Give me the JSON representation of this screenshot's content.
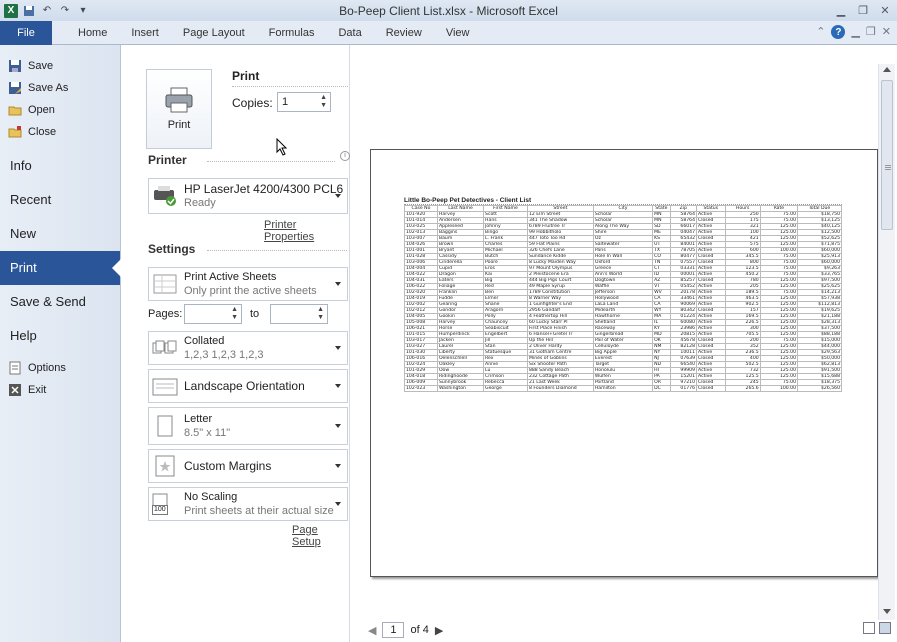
{
  "window": {
    "title": "Bo-Peep Client List.xlsx - Microsoft Excel",
    "app_icon": "X"
  },
  "ribbon": {
    "tabs": [
      "File",
      "Home",
      "Insert",
      "Page Layout",
      "Formulas",
      "Data",
      "Review",
      "View"
    ]
  },
  "nav": {
    "small_top": [
      {
        "label": "Save",
        "icon": "save-icon"
      },
      {
        "label": "Save As",
        "icon": "save-as-icon"
      },
      {
        "label": "Open",
        "icon": "open-folder-icon"
      },
      {
        "label": "Close",
        "icon": "close-file-icon"
      }
    ],
    "large": [
      "Info",
      "Recent",
      "New",
      "Print",
      "Save & Send",
      "Help"
    ],
    "active": "Print",
    "small_bottom": [
      {
        "label": "Options",
        "icon": "options-icon"
      },
      {
        "label": "Exit",
        "icon": "exit-icon"
      }
    ]
  },
  "print_panel": {
    "heading": "Print",
    "button_label": "Print",
    "copies_label": "Copies:",
    "copies_value": "1",
    "printer_heading": "Printer",
    "printer_name": "HP LaserJet 4200/4300 PCL6",
    "printer_status": "Ready",
    "printer_properties": "Printer Properties",
    "settings_heading": "Settings",
    "what_main": "Print Active Sheets",
    "what_sub": "Only print the active sheets",
    "pages_label": "Pages:",
    "pages_from": "",
    "pages_to_label": "to",
    "pages_to": "",
    "collate_main": "Collated",
    "collate_sub": "1,2,3   1,2,3   1,2,3",
    "orientation": "Landscape Orientation",
    "paper_main": "Letter",
    "paper_sub": "8.5\" x 11\"",
    "margins": "Custom Margins",
    "scaling_main": "No Scaling",
    "scaling_sub": "Print sheets at their actual size",
    "scaling_badge": "100",
    "page_setup": "Page Setup"
  },
  "preview": {
    "sheet_title": "Little Bo-Peep Pet Detectives - Client List",
    "headers": [
      "Case No",
      "Last Name",
      "First Name",
      "Street",
      "City",
      "State",
      "Zip",
      "Status",
      "Hours",
      "Rate",
      "Total Due"
    ],
    "rows": [
      [
        "101-920",
        "Harvey",
        "Scott",
        "12 Elm Street",
        "Scholar",
        "MN",
        "58764",
        "Active",
        "250",
        "75.00",
        "$18,750"
      ],
      [
        "101-014",
        "Andersen",
        "Hans",
        "341 The Shadow",
        "Scholar",
        "MN",
        "58764",
        "Closed",
        "175",
        "75.00",
        "$13,125"
      ],
      [
        "103-025",
        "Appleseed",
        "Johnny",
        "6789 Fruitree Tr",
        "Along The Way",
        "SD",
        "66017",
        "Active",
        "321",
        "125.00",
        "$40,125"
      ],
      [
        "102-013",
        "Baggins",
        "Bingo",
        "99 Hobbitholo",
        "Shire",
        "ME",
        "04047",
        "Active",
        "100",
        "125.00",
        "$12,500"
      ],
      [
        "103-007",
        "Baum",
        "L. Frank",
        "447 Toto Too Rd",
        "Oz",
        "KS",
        "65432",
        "Closed",
        "421",
        "125.00",
        "$52,625"
      ],
      [
        "104-026",
        "Brown",
        "Charles",
        "59 Flat Plains",
        "Saltewater",
        "UT",
        "84001",
        "Active",
        "575",
        "125.00",
        "$71,875"
      ],
      [
        "101-001",
        "Bryant",
        "Michael",
        "326 Chefs Lane",
        "Paris",
        "TX",
        "78705",
        "Active",
        "600",
        "100.00",
        "$60,000"
      ],
      [
        "101-028",
        "Cassidy",
        "Butch",
        "Sundance Kidde",
        "Hole In Wall",
        "CO",
        "80477",
        "Closed",
        "345.5",
        "75.00",
        "$25,913"
      ],
      [
        "103-006",
        "Cinderella",
        "Poore",
        "8 Lucky Maiden Way",
        "Oxford",
        "TN",
        "07557",
        "Closed",
        "800",
        "75.00",
        "$60,000"
      ],
      [
        "104-004",
        "Cupid",
        "Eros",
        "97 Mount Olympus",
        "Greece",
        "CT",
        "03331",
        "Active",
        "123.5",
        "75.00",
        "$9,263"
      ],
      [
        "104-022",
        "Dragon",
        "Kai",
        "2 Pleistocene Era",
        "Ann's World",
        "ID",
        "00001",
        "Active",
        "450.2",
        "75.00",
        "$33,765"
      ],
      [
        "104-031",
        "Eaters",
        "Big",
        "444 Big Pigs Court",
        "Dogtown",
        "AZ",
        "85257",
        "Closed",
        "780",
        "125.00",
        "$97,500"
      ],
      [
        "106-022",
        "Foliage",
        "Red",
        "49 Maple Syrup",
        "Waffle",
        "VT",
        "05452",
        "Active",
        "205",
        "125.00",
        "$25,625"
      ],
      [
        "102-020",
        "Franklin",
        "Ben",
        "1789 Constitution",
        "Jefferson",
        "WV",
        "20178",
        "Active",
        "189.5",
        "75.00",
        "$14,213"
      ],
      [
        "104-019",
        "Fudde",
        "Elmer",
        "8 Warner Way",
        "Hollywood",
        "CA",
        "33461",
        "Active",
        "463.5",
        "125.00",
        "$57,938"
      ],
      [
        "102-002",
        "Gearing",
        "Shane",
        "1 Gunfighter's End",
        "LaLa Land",
        "CA",
        "90069",
        "Active",
        "902.5",
        "125.00",
        "$112,813"
      ],
      [
        "102-012",
        "Gondor",
        "Aragorn",
        "2956 Gandalf",
        "Midearth",
        "WY",
        "80342",
        "Closed",
        "157",
        "125.00",
        "$19,625"
      ],
      [
        "104-005",
        "Gookin",
        "Polly",
        "4 Feathertop Hill",
        "Hawthorne",
        "MA",
        "01224",
        "Active",
        "169.5",
        "125.00",
        "$21,188"
      ],
      [
        "105-008",
        "Harvey",
        "Chauncey",
        "60 Lucky Starr Pl",
        "Shetland",
        "IL",
        "60080",
        "Active",
        "226.5",
        "125.00",
        "$28,313"
      ],
      [
        "106-021",
        "Horse",
        "Seabiscuit",
        "First Place Finish",
        "Raceway",
        "KY",
        "23986",
        "Active",
        "300",
        "125.00",
        "$37,500"
      ],
      [
        "101-015",
        "Humperdinck",
        "Engelbert",
        "6 Hansel+Gretel Tr",
        "Gingerbread",
        "MD",
        "20815",
        "Active",
        "705.5",
        "125.00",
        "$88,188"
      ],
      [
        "103-017",
        "Jacken",
        "Jill",
        "Up the Hill",
        "Pail of Water",
        "OK",
        "45678",
        "Closed",
        "200",
        "75.00",
        "$15,000"
      ],
      [
        "103-027",
        "Laurel",
        "Stan",
        "2 Oliver Hardy",
        "Celluloyde",
        "NM",
        "82128",
        "Closed",
        "352",
        "125.00",
        "$44,000"
      ],
      [
        "101-030",
        "Liberty",
        "Statuesque",
        "31 Gotham Centre",
        "Big Apple",
        "NY",
        "10011",
        "Active",
        "236.5",
        "125.00",
        "$29,563"
      ],
      [
        "106-016",
        "Oelenschlell",
        "Rex",
        "Mines of Goblins",
        "Everest",
        "NJ",
        "07639",
        "Closed",
        "400",
        "125.00",
        "$50,000"
      ],
      [
        "102-024",
        "Oakley",
        "Annie",
        "Six Shooter Path",
        "Target",
        "ND",
        "66540",
        "Active",
        "502.5",
        "125.00",
        "$62,813"
      ],
      [
        "101-029",
        "Oow",
        "Lu",
        "888 Sandy Beach",
        "Honolulu",
        "HI",
        "99909",
        "Active",
        "732",
        "125.00",
        "$91,500"
      ],
      [
        "104-018",
        "Ridinghoode",
        "Crimson",
        "232 Cottage Path",
        "Wulfen",
        "PA",
        "15201",
        "Active",
        "125.5",
        "125.00",
        "$15,688"
      ],
      [
        "106-009",
        "Sunnybrook",
        "Rebecca",
        "21 Last Week",
        "Portland",
        "OR",
        "97210",
        "Closed",
        "245",
        "75.00",
        "$18,375"
      ],
      [
        "102-023",
        "Washington",
        "George",
        "8 Founders Diamond",
        "Hamilton",
        "DC",
        "01776",
        "Closed",
        "265.6",
        "100.00",
        "$26,560"
      ]
    ],
    "page_current": "1",
    "page_total": "of 4"
  }
}
